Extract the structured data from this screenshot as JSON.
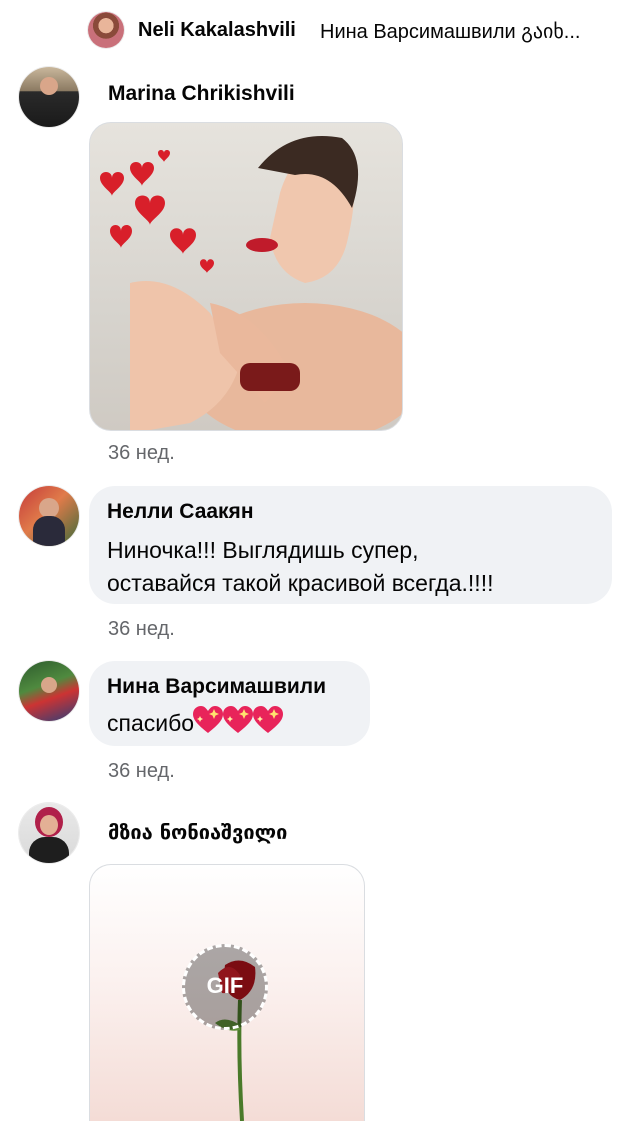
{
  "reply_preview": {
    "author": "Neli Kakalashvili",
    "text": "Нина Варсимашвили გაიხ..."
  },
  "comments": [
    {
      "author": "Marina Chrikishvili",
      "attachment": "photo",
      "time": "36 нед."
    },
    {
      "author": "Нелли Саакян",
      "lines": [
        "Ниночка!!! Выглядишь супер,",
        "оставайся такой красивой всегда.!!!!"
      ],
      "time": "36 нед."
    },
    {
      "author": "Нина Варсимашвили",
      "text": "спасибо",
      "emoji": [
        "sparkling-heart-icon",
        "sparkling-heart-icon",
        "sparkling-heart-icon"
      ],
      "time": "36 нед."
    },
    {
      "author": "მზია ნონიაშვილი",
      "attachment": "gif",
      "gif_label": "GIF"
    }
  ],
  "colors": {
    "bubble": "#f0f2f5",
    "meta": "#65676b",
    "heart": "#e8245a"
  }
}
